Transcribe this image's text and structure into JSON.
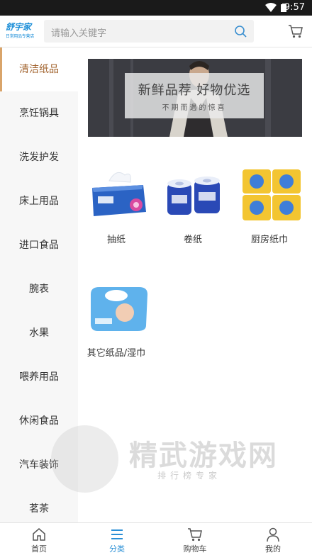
{
  "status_bar": {
    "time": "9:57"
  },
  "header": {
    "logo_text": "舒宇家",
    "logo_sub": "日常用品专营店",
    "search_placeholder": "请输入关键字"
  },
  "sidebar": {
    "active_index": 0,
    "items": [
      {
        "label": "清洁纸品"
      },
      {
        "label": "烹饪锅具"
      },
      {
        "label": "洗发护发"
      },
      {
        "label": "床上用品"
      },
      {
        "label": "进口食品"
      },
      {
        "label": "腕表"
      },
      {
        "label": "水果"
      },
      {
        "label": "喂养用品"
      },
      {
        "label": "休闲食品"
      },
      {
        "label": "汽车装饰"
      },
      {
        "label": "茗茶"
      }
    ]
  },
  "banner": {
    "title": "新鲜品荐 好物优选",
    "subtitle": "不期而遇的惊喜"
  },
  "products": [
    {
      "name": "抽纸",
      "icon": "tissue-box-icon"
    },
    {
      "name": "卷纸",
      "icon": "toilet-roll-icon"
    },
    {
      "name": "厨房纸巾",
      "icon": "kitchen-towel-icon"
    },
    {
      "name": "其它纸品/湿巾",
      "icon": "wet-wipes-icon"
    }
  ],
  "watermark": {
    "title": "精武游戏网",
    "subtitle": "排行榜专家"
  },
  "tabbar": {
    "active_index": 1,
    "tabs": [
      {
        "label": "首页",
        "icon": "home-icon"
      },
      {
        "label": "分类",
        "icon": "category-icon"
      },
      {
        "label": "购物车",
        "icon": "cart-icon"
      },
      {
        "label": "我的",
        "icon": "user-icon"
      }
    ]
  },
  "colors": {
    "accent": "#2a8fd6",
    "sidebar_active": "#a0602a",
    "sidebar_indicator": "#d9a46a",
    "status_bar": "#1a1a1a"
  }
}
